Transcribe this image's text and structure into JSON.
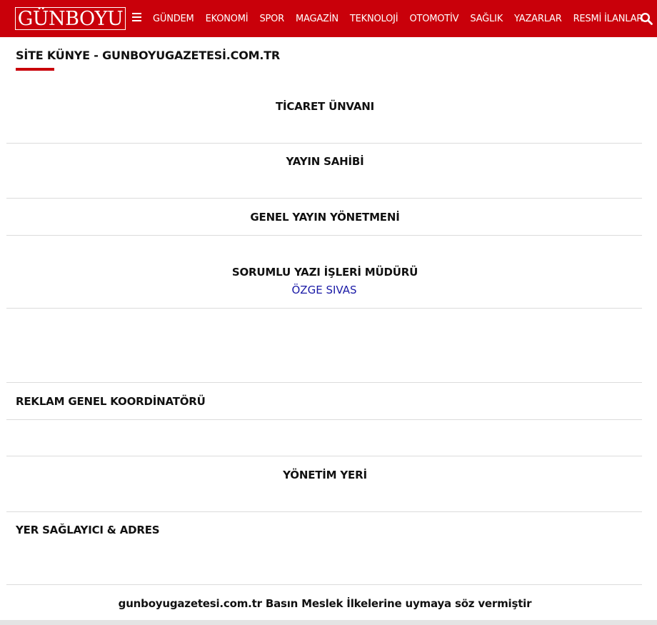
{
  "header": {
    "logo_text": "GÜNBOYU",
    "nav": [
      "GÜNDEM",
      "EKONOMİ",
      "SPOR",
      "MAGAZİN",
      "TEKNOLOJİ",
      "OTOMOTİV",
      "SAĞLIK",
      "YAZARLAR",
      "RESMİ İLANLAR"
    ],
    "icons": {
      "menu": "hamburger-menu-icon",
      "search": "search-icon"
    },
    "colors": {
      "brand_red": "#c9000a",
      "nav_text": "#ffffff"
    }
  },
  "page": {
    "title": "SİTE KÜNYE - GUNBOYUGAZETESİ.COM.TR"
  },
  "sections": {
    "trade_name": "TİCARET ÜNVANI",
    "publisher": "YAYIN SAHİBİ",
    "editor_in_chief": "GENEL YAYIN YÖNETMENİ",
    "managing_editor": "SORUMLU YAZI İŞLERİ MÜDÜRÜ",
    "managing_editor_name": "ÖZGE SIVAS",
    "ad_coordinator": "REKLAM GENEL KOORDİNATÖRÜ",
    "management_office": "YÖNETİM YERİ",
    "hosting": "YER SAĞLAYICI & ADRES"
  },
  "footer": {
    "statement": "gunboyugazetesi.com.tr Basın Meslek İlkelerine uymaya söz vermiştir"
  }
}
